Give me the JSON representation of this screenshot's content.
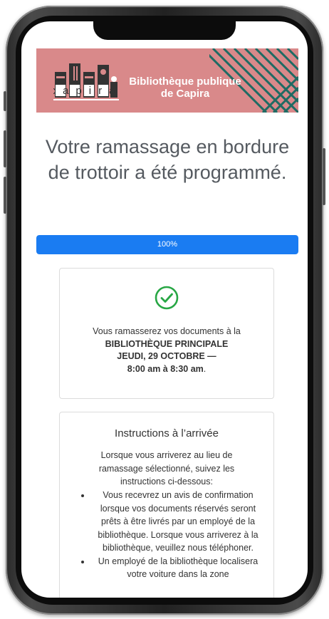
{
  "library": {
    "logo_text": "capira",
    "name_line1": "Bibliothèque publique",
    "name_line2": "de Capira",
    "banner_color": "#d9898a"
  },
  "page_title": "Votre ramassage en bordure de trottoir a été programmé.",
  "progress": {
    "value_percent": 100,
    "label": "100%",
    "color": "#1a7cf2"
  },
  "confirmation": {
    "icon": "check-circle-icon",
    "icon_color": "#28a745",
    "intro": "Vous ramasserez vos documents à la",
    "location": "BIBLIOTHÈQUE PRINCIPALE",
    "date": "JEUDI, 29 OCTOBRE —",
    "time": "8:00 am à 8:30 am",
    "time_suffix": "."
  },
  "instructions": {
    "title": "Instructions à l’arrivée",
    "intro": "Lorsque vous arriverez au lieu de ramassage sélectionné, suivez les instructions ci-dessous:",
    "items": [
      "Vous recevrez un avis de confirmation lorsque vos documents réservés seront prêts à être livrés par un employé de la bibliothèque. Lorsque vous arriverez à la bibliothèque, veuillez nous téléphoner.",
      "Un employé de la bibliothèque localisera votre voiture dans la zone"
    ]
  }
}
